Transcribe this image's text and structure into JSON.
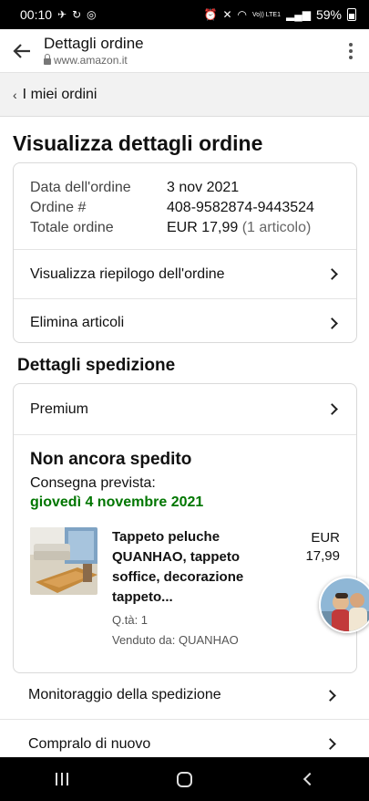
{
  "status_bar": {
    "time": "00:10",
    "signal_label": "Vo))\nLTE1",
    "battery": "59%"
  },
  "browser": {
    "title": "Dettagli ordine",
    "url": "www.amazon.it"
  },
  "breadcrumb": {
    "label": "I miei ordini"
  },
  "page_title": "Visualizza dettagli ordine",
  "order": {
    "date_label": "Data dell'ordine",
    "date_value": "3 nov 2021",
    "number_label": "Ordine #",
    "number_value": "408-9582874-9443524",
    "total_label": "Totale ordine",
    "total_value": "EUR 17,99",
    "total_count": "(1 articolo)",
    "summary_link": "Visualizza riepilogo dell'ordine",
    "delete_link": "Elimina articoli"
  },
  "shipping": {
    "section_title": "Dettagli spedizione",
    "premium_label": "Premium",
    "status": "Non ancora spedito",
    "delivery_label": "Consegna prevista:",
    "delivery_date": "giovedì 4 novembre 2021",
    "item": {
      "title": "Tappeto peluche QUANHAO, tappeto soffice, decorazione tappeto...",
      "quantity": "Q.tà: 1",
      "seller": "Venduto da: QUANHAO",
      "price_currency": "EUR",
      "price_amount": "17,99"
    },
    "track_link": "Monitoraggio della spedizione",
    "buy_again_link": "Compralo di nuovo"
  }
}
